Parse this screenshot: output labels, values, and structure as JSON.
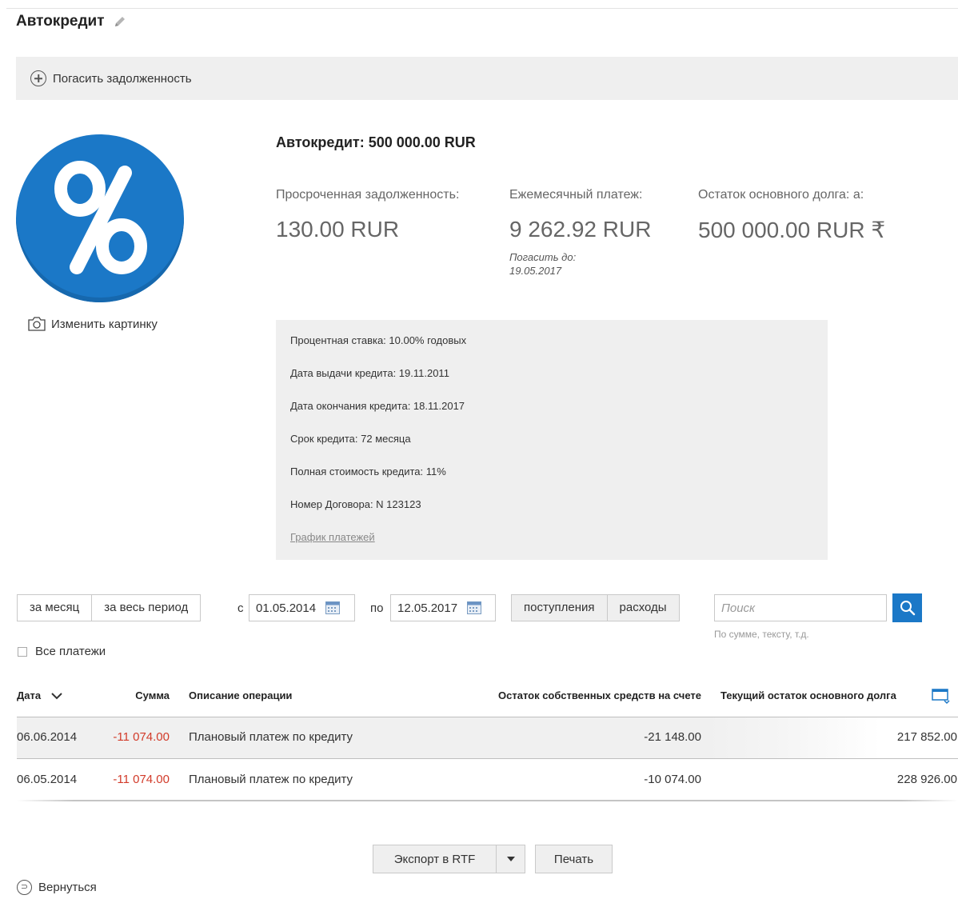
{
  "page": {
    "title": "Автокредит",
    "pay_debt_label": "Погасить задолженность"
  },
  "loan": {
    "heading": "Автокредит: 500 000.00 RUR",
    "change_picture_label": "Изменить картинку",
    "stats": [
      {
        "label": "Просроченная задолженность:",
        "value": "130.00 RUR"
      },
      {
        "label": "Ежемесячный платеж:",
        "value": "9 262.92 RUR",
        "note_label": "Погасить до:",
        "note_date": "19.05.2017"
      },
      {
        "label": "Остаток основного долга: а:",
        "value": "500 000.00 RUR ₹"
      }
    ],
    "details": [
      "Процентная ставка: 10.00% годовых",
      "Дата выдачи кредита: 19.11.2011",
      "Дата окончания кредита: 18.11.2017",
      "Срок кредита: 72 месяца",
      "Полная стоимость кредита: 11%",
      "Номер Договора: N 123123"
    ],
    "schedule_link": "График платежей"
  },
  "filters": {
    "period_month": "за месяц",
    "period_all": "за весь период",
    "from_label": "с",
    "from_date": "01.05.2014",
    "to_label": "по",
    "to_date": "12.05.2017",
    "incoming": "поступления",
    "outgoing": "расходы",
    "search_placeholder": "Поиск",
    "search_hint": "По сумме, тексту, т.д.",
    "all_payments": "Все платежи"
  },
  "table": {
    "headers": {
      "date": "Дата",
      "amount": "Сумма",
      "description": "Описание операции",
      "own_balance": "Остаток собственных средств на счете",
      "principal_balance": "Текущий остаток основного долга"
    },
    "rows": [
      {
        "date": "06.06.2014",
        "amount": "-11 074.00",
        "description": "Плановый платеж по кредиту",
        "own_balance": "-21 148.00",
        "principal_balance": "217 852.00"
      },
      {
        "date": "06.05.2014",
        "amount": "-11 074.00",
        "description": "Плановый платеж по кредиту",
        "own_balance": "-10 074.00",
        "principal_balance": "228 926.00"
      }
    ]
  },
  "footer": {
    "export_label": "Экспорт в RTF",
    "print_label": "Печать",
    "back_label": "Вернуться"
  },
  "colors": {
    "accent": "#1b78c7",
    "negative": "#d23b2a"
  }
}
